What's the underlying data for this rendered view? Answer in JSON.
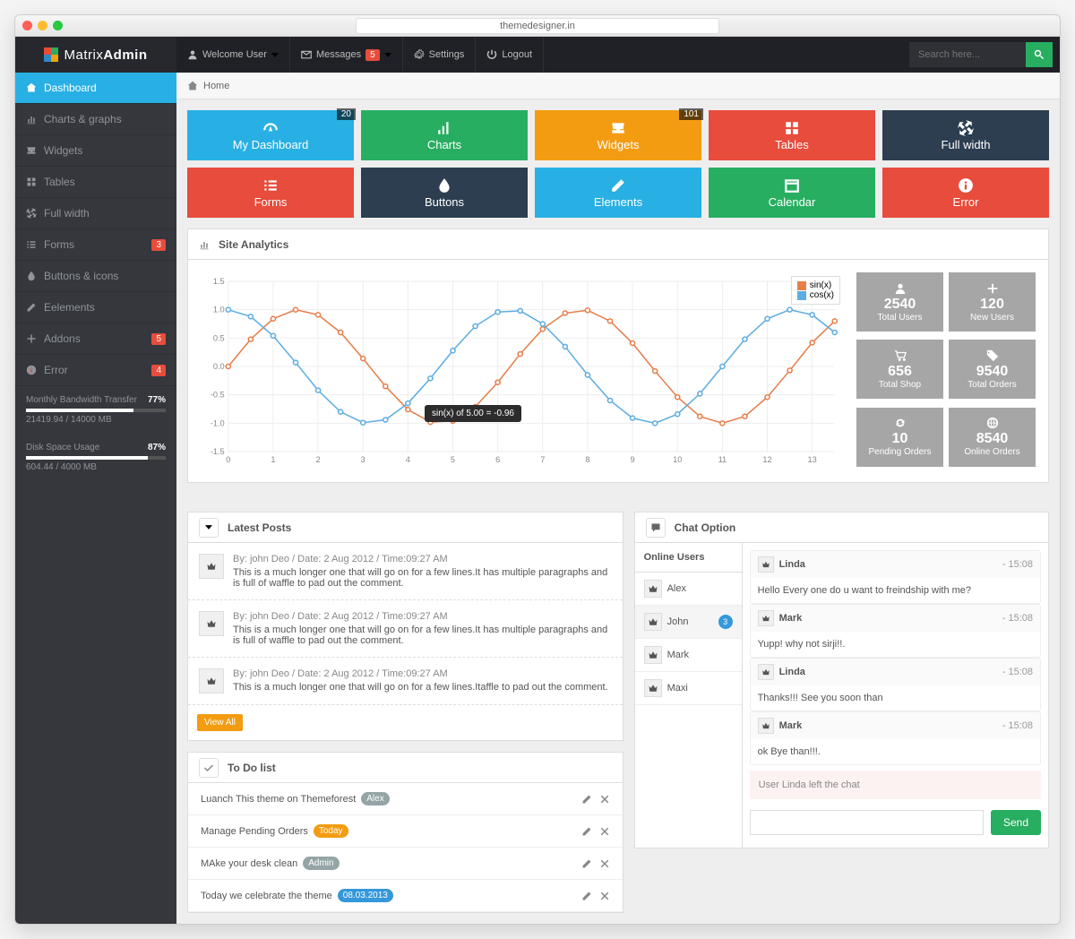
{
  "browser": {
    "url": "themedesigner.in"
  },
  "logo": {
    "light": "Matrix ",
    "bold": "Admin"
  },
  "topbar": {
    "welcome": "Welcome User",
    "messages": "Messages",
    "messages_badge": "5",
    "settings": "Settings",
    "logout": "Logout",
    "search_placeholder": "Search here..."
  },
  "breadcrumb": {
    "home": "Home"
  },
  "sidebar": {
    "items": [
      {
        "label": "Dashboard",
        "active": true
      },
      {
        "label": "Charts & graphs"
      },
      {
        "label": "Widgets"
      },
      {
        "label": "Tables"
      },
      {
        "label": "Full width"
      },
      {
        "label": "Forms",
        "badge": "3"
      },
      {
        "label": "Buttons & icons"
      },
      {
        "label": "Eelements"
      },
      {
        "label": "Addons",
        "badge": "5"
      },
      {
        "label": "Error",
        "badge": "4"
      }
    ],
    "progress": [
      {
        "title": "Monthly Bandwidth Transfer",
        "pct": "77%",
        "sub": "21419.94 / 14000 MB",
        "w": 77
      },
      {
        "title": "Disk Space Usage",
        "pct": "87%",
        "sub": "604.44 / 4000 MB",
        "w": 87
      }
    ]
  },
  "tiles_top": [
    {
      "label": "My Dashboard",
      "color": "#28b0e4",
      "badge": "20",
      "icon": "gauge-icon"
    },
    {
      "label": "Charts",
      "color": "#27ae60",
      "icon": "bars-icon"
    },
    {
      "label": "Widgets",
      "color": "#f39c12",
      "badge": "101",
      "icon": "inbox-icon"
    },
    {
      "label": "Tables",
      "color": "#e74c3c",
      "icon": "grid-icon"
    },
    {
      "label": "Full width",
      "color": "#2c3e50",
      "icon": "expand-icon"
    }
  ],
  "tiles_bottom": [
    {
      "label": "Forms",
      "color": "#e74c3c",
      "icon": "list-icon"
    },
    {
      "label": "Buttons",
      "color": "#2c3e50",
      "icon": "drop-icon"
    },
    {
      "label": "Elements",
      "color": "#28b0e4",
      "icon": "pencil-icon"
    },
    {
      "label": "Calendar",
      "color": "#27ae60",
      "icon": "calendar-icon"
    },
    {
      "label": "Error",
      "color": "#e74c3c",
      "icon": "info-icon"
    }
  ],
  "analytics": {
    "title": "Site Analytics",
    "tooltip": "sin(x) of 5.00 = -0.96",
    "legend": [
      {
        "name": "sin(x)",
        "color": "#e67e4a"
      },
      {
        "name": "cos(x)",
        "color": "#5dade2"
      }
    ]
  },
  "chart_data": {
    "type": "line",
    "xlabel": "",
    "ylabel": "",
    "xlim": [
      0,
      13.5
    ],
    "ylim": [
      -1.5,
      1.5
    ],
    "x_ticks": [
      0,
      1,
      2,
      3,
      4,
      5,
      6,
      7,
      8,
      9,
      10,
      11,
      12,
      13
    ],
    "y_ticks": [
      -1.5,
      -1.0,
      -0.5,
      0.0,
      0.5,
      1.0,
      1.5
    ],
    "x": [
      0,
      0.5,
      1,
      1.5,
      2,
      2.5,
      3,
      3.5,
      4,
      4.5,
      5,
      5.5,
      6,
      6.5,
      7,
      7.5,
      8,
      8.5,
      9,
      9.5,
      10,
      10.5,
      11,
      11.5,
      12,
      12.5,
      13,
      13.5
    ],
    "series": [
      {
        "name": "sin(x)",
        "color": "#e67e4a",
        "values": [
          0,
          0.48,
          0.84,
          1.0,
          0.91,
          0.6,
          0.14,
          -0.35,
          -0.76,
          -0.98,
          -0.96,
          -0.71,
          -0.28,
          0.22,
          0.66,
          0.94,
          0.99,
          0.8,
          0.41,
          -0.08,
          -0.54,
          -0.88,
          -1.0,
          -0.88,
          -0.54,
          -0.07,
          0.42,
          0.8
        ]
      },
      {
        "name": "cos(x)",
        "color": "#5dade2",
        "values": [
          1,
          0.88,
          0.54,
          0.07,
          -0.42,
          -0.8,
          -0.99,
          -0.94,
          -0.65,
          -0.21,
          0.28,
          0.71,
          0.96,
          0.98,
          0.75,
          0.35,
          -0.15,
          -0.6,
          -0.91,
          -1.0,
          -0.84,
          -0.48,
          0,
          0.48,
          0.84,
          1.0,
          0.91,
          0.6
        ]
      }
    ]
  },
  "stats": [
    {
      "num": "2540",
      "lbl": "Total Users",
      "icon": "user-icon"
    },
    {
      "num": "120",
      "lbl": "New Users",
      "icon": "plus-icon"
    },
    {
      "num": "656",
      "lbl": "Total Shop",
      "icon": "cart-icon"
    },
    {
      "num": "9540",
      "lbl": "Total Orders",
      "icon": "tag-icon"
    },
    {
      "num": "10",
      "lbl": "Pending Orders",
      "icon": "refresh-icon"
    },
    {
      "num": "8540",
      "lbl": "Online Orders",
      "icon": "globe-icon"
    }
  ],
  "latest_posts": {
    "title": "Latest Posts",
    "view_all": "View All",
    "items": [
      {
        "meta": "By: john Deo / Date: 2 Aug 2012 / Time:09:27 AM",
        "body": "This is a much longer one that will go on for a few lines.It has multiple paragraphs and is full of waffle to pad out the comment."
      },
      {
        "meta": "By: john Deo / Date: 2 Aug 2012 / Time:09:27 AM",
        "body": "This is a much longer one that will go on for a few lines.It has multiple paragraphs and is full of waffle to pad out the comment."
      },
      {
        "meta": "By: john Deo / Date: 2 Aug 2012 / Time:09:27 AM",
        "body": "This is a much longer one that will go on for a few lines.Itaffle to pad out the comment."
      }
    ]
  },
  "todo": {
    "title": "To Do list",
    "items": [
      {
        "text": "Luanch This theme on Themeforest",
        "tag": "Alex",
        "tag_color": "#95a5a6"
      },
      {
        "text": "Manage Pending Orders",
        "tag": "Today",
        "tag_color": "#f39c12"
      },
      {
        "text": "MAke your desk clean",
        "tag": "Admin",
        "tag_color": "#95a5a6"
      },
      {
        "text": "Today we celebrate the theme",
        "tag": "08.03.2013",
        "tag_color": "#3498db"
      }
    ]
  },
  "chat": {
    "title": "Chat Option",
    "online_title": "Online Users",
    "users": [
      {
        "name": "Alex"
      },
      {
        "name": "John",
        "badge": "3",
        "active": true
      },
      {
        "name": "Mark"
      },
      {
        "name": "Maxi"
      }
    ],
    "messages": [
      {
        "name": "Linda",
        "time": "- 15:08",
        "text": "Hello Every one do u want to freindship with me?"
      },
      {
        "name": "Mark",
        "time": "- 15:08",
        "text": "Yupp! why not sirji!!."
      },
      {
        "name": "Linda",
        "time": "- 15:08",
        "text": "Thanks!!! See you soon than"
      },
      {
        "name": "Mark",
        "time": "- 15:08",
        "text": "ok Bye than!!!."
      }
    ],
    "left": "User Linda left the chat",
    "send": "Send"
  }
}
